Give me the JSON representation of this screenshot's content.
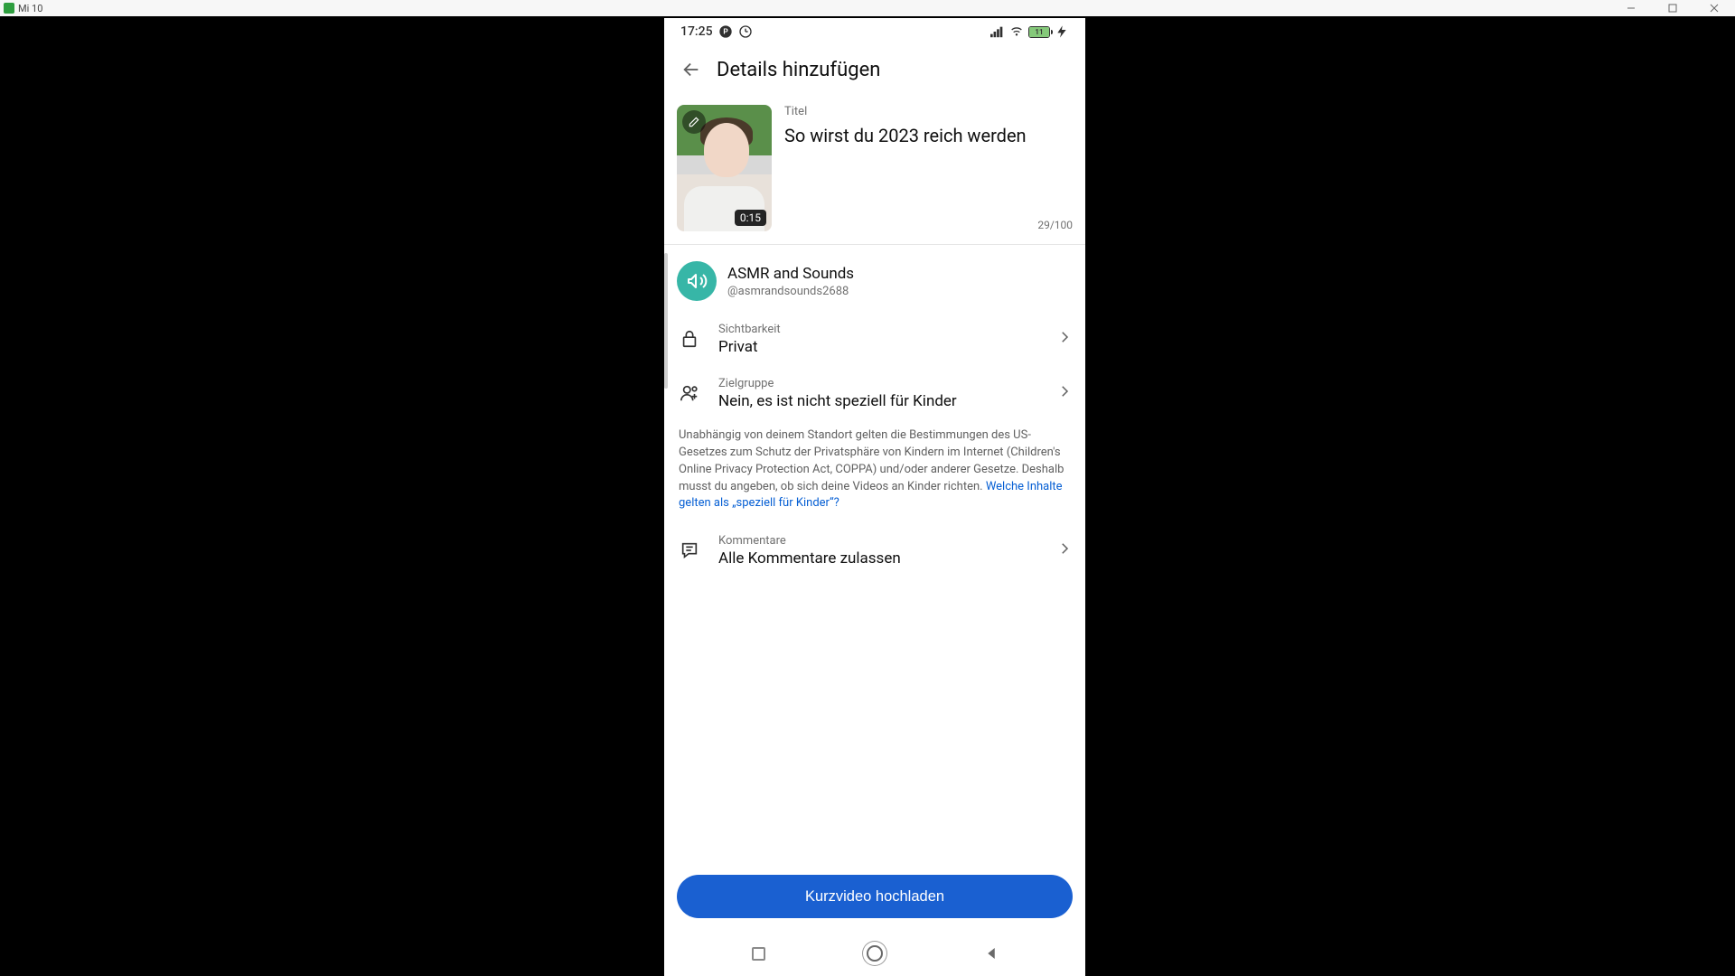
{
  "window": {
    "device_label": "Mi 10"
  },
  "statusbar": {
    "time": "17:25",
    "battery_text": "11"
  },
  "appbar": {
    "title": "Details hinzufügen"
  },
  "video": {
    "title_label": "Titel",
    "title_value": "So wirst du 2023 reich werden",
    "char_count": "29/100",
    "duration": "0:15"
  },
  "channel": {
    "name": "ASMR and Sounds",
    "handle": "@asmrandsounds2688"
  },
  "settings": {
    "visibility": {
      "label": "Sichtbarkeit",
      "value": "Privat"
    },
    "audience": {
      "label": "Zielgruppe",
      "value": "Nein, es ist nicht speziell für Kinder"
    },
    "comments": {
      "label": "Kommentare",
      "value": "Alle Kommentare zulassen"
    }
  },
  "coppa": {
    "text": "Unabhängig von deinem Standort gelten die Bestimmungen des US-Gesetzes zum Schutz der Privatsphäre von Kindern im Internet (Children's Online Privacy Protection Act, COPPA) und/oder anderer Gesetze. Deshalb musst du angeben, ob sich deine Videos an Kinder richten. ",
    "link": "Welche Inhalte gelten als „speziell für Kinder“?"
  },
  "upload": {
    "button_label": "Kurzvideo hochladen"
  }
}
